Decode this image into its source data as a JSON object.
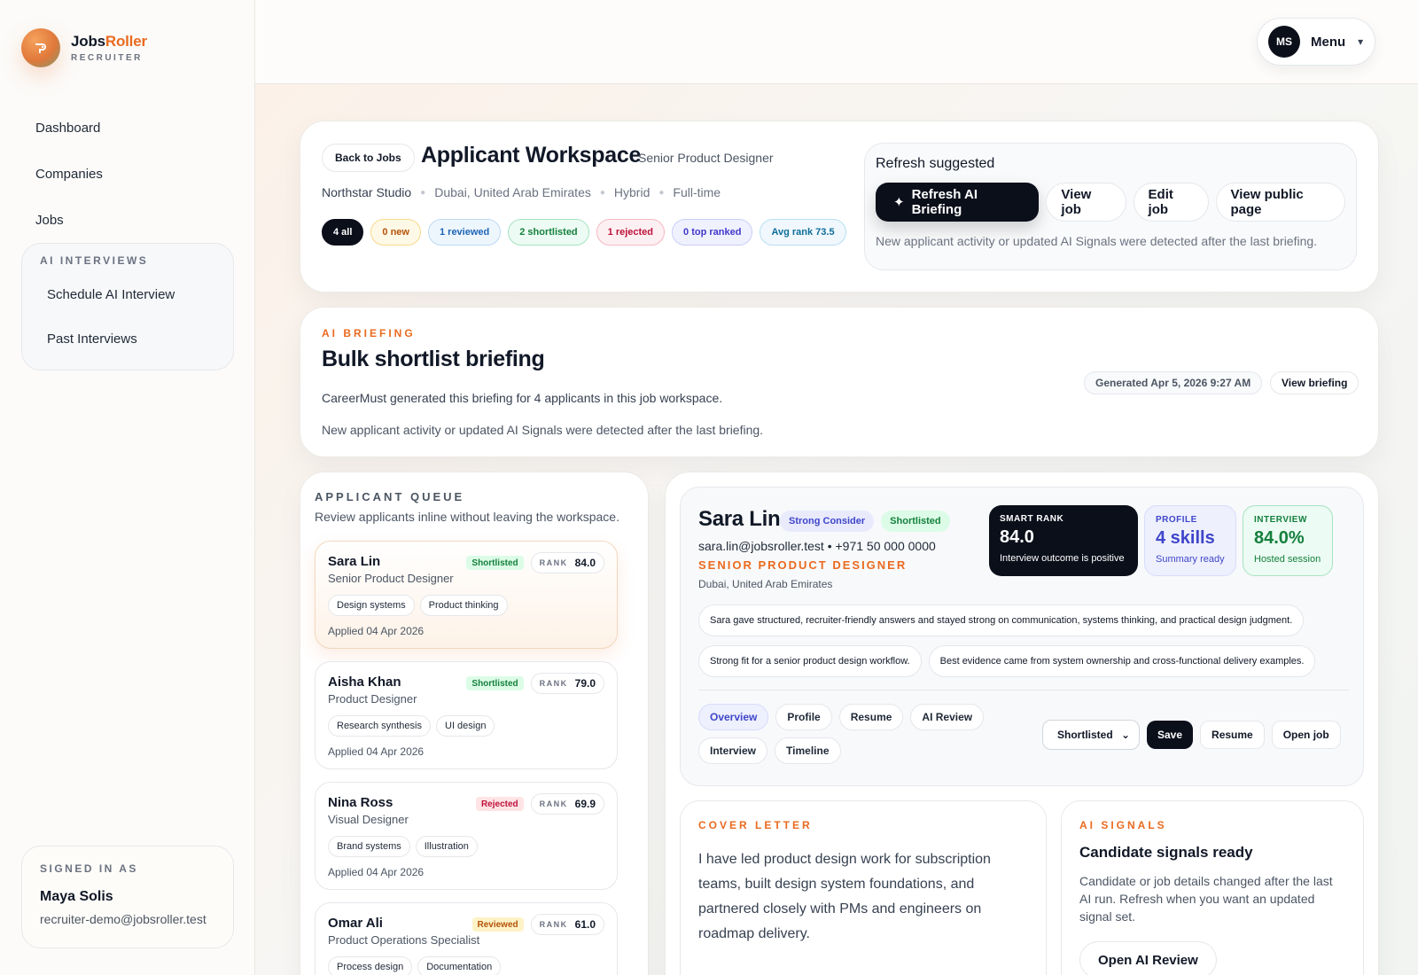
{
  "brand": {
    "name_main": "Jobs",
    "name_accent": "Roller",
    "sub": "RECRUITER",
    "accent": "#ea6a1f"
  },
  "nav": {
    "items": [
      "Dashboard",
      "Companies",
      "Jobs"
    ],
    "group_title": "AI INTERVIEWS",
    "group_items": [
      "Schedule AI Interview",
      "Past Interviews"
    ]
  },
  "signed_in": {
    "title": "SIGNED IN AS",
    "name": "Maya Solis",
    "email": "recruiter-demo@jobsroller.test"
  },
  "topbar": {
    "avatar": "MS",
    "menu": "Menu",
    "chevron": "▾"
  },
  "header": {
    "back": "Back to Jobs",
    "title": "Applicant Workspace",
    "role": "Senior Product Designer",
    "company": "Northstar Studio",
    "location": "Dubai, United Arab Emirates",
    "mode": "Hybrid",
    "type": "Full-time",
    "pills": [
      {
        "label": "4 all",
        "bg": "#0b0f1a",
        "fg": "#ffffff",
        "bd": "#0b0f1a"
      },
      {
        "label": "0 new",
        "bg": "#fef9e7",
        "fg": "#b45309",
        "bd": "#f6d98a"
      },
      {
        "label": "1 reviewed",
        "bg": "#eef6fd",
        "fg": "#1d64b5",
        "bd": "#bcd9f3"
      },
      {
        "label": "2 shortlisted",
        "bg": "#ecfbf3",
        "fg": "#15803d",
        "bd": "#a6e3c1"
      },
      {
        "label": "1 rejected",
        "bg": "#fdf0f2",
        "fg": "#be123c",
        "bd": "#f5b8c4"
      },
      {
        "label": "0 top ranked",
        "bg": "#f0f1fe",
        "fg": "#4338ca",
        "bd": "#c9cdf8"
      },
      {
        "label": "Avg rank 73.5",
        "bg": "#f0f8fd",
        "fg": "#0e6d99",
        "bd": "#b7def2"
      }
    ],
    "refresh": {
      "title": "Refresh suggested",
      "primary": "Refresh AI Briefing",
      "buttons": [
        "View job",
        "Edit job",
        "View public page"
      ],
      "note": "New applicant activity or updated AI Signals were detected after the last briefing."
    }
  },
  "briefing": {
    "eyebrow": "AI BRIEFING",
    "title": "Bulk shortlist briefing",
    "line1": "CareerMust generated this briefing for 4 applicants in this job workspace.",
    "line2": "New applicant activity or updated AI Signals were detected after the last briefing.",
    "generated": "Generated Apr 5, 2026 9:27 AM",
    "view": "View briefing"
  },
  "queue": {
    "title": "APPLICANT QUEUE",
    "subtitle": "Review applicants inline without leaving the workspace.",
    "rank_label": "RANK",
    "applicants": [
      {
        "name": "Sara Lin",
        "role": "Senior Product Designer",
        "status": "Shortlisted",
        "status_bg": "#dcfce7",
        "status_fg": "#15803d",
        "rank": "84.0",
        "tags": [
          "Design systems",
          "Product thinking"
        ],
        "date": "Applied 04 Apr 2026"
      },
      {
        "name": "Aisha Khan",
        "role": "Product Designer",
        "status": "Shortlisted",
        "status_bg": "#dcfce7",
        "status_fg": "#15803d",
        "rank": "79.0",
        "tags": [
          "Research synthesis",
          "UI design"
        ],
        "date": "Applied 04 Apr 2026"
      },
      {
        "name": "Nina Ross",
        "role": "Visual Designer",
        "status": "Rejected",
        "status_bg": "#ffe4e6",
        "status_fg": "#be123c",
        "rank": "69.9",
        "tags": [
          "Brand systems",
          "Illustration"
        ],
        "date": "Applied 04 Apr 2026"
      },
      {
        "name": "Omar Ali",
        "role": "Product Operations Specialist",
        "status": "Reviewed",
        "status_bg": "#fef3c7",
        "status_fg": "#b45309",
        "rank": "61.0",
        "tags": [
          "Process design",
          "Documentation"
        ],
        "date": ""
      }
    ]
  },
  "profile": {
    "name": "Sara Lin",
    "badges": [
      {
        "label": "Strong Consider",
        "bg": "#e9ebfd",
        "fg": "#3f46c9"
      },
      {
        "label": "Shortlisted",
        "bg": "#dcfce7",
        "fg": "#15803d"
      }
    ],
    "contact": "sara.lin@jobsroller.test • +971 50 000 0000",
    "role": "SENIOR PRODUCT DESIGNER",
    "location": "Dubai, United Arab Emirates",
    "stats": [
      {
        "label": "SMART RANK",
        "value": "84.0",
        "sub": "Interview outcome is positive"
      },
      {
        "label": "PROFILE",
        "value": "4 skills",
        "sub": "Summary ready"
      },
      {
        "label": "INTERVIEW",
        "value": "84.0%",
        "sub": "Hosted session"
      }
    ],
    "insights": [
      "Sara gave structured, recruiter-friendly answers and stayed strong on communication, systems thinking, and practical design judgment.",
      "Strong fit for a senior product design workflow.",
      "Best evidence came from system ownership and cross-functional delivery examples."
    ],
    "tabs": [
      "Overview",
      "Profile",
      "Resume",
      "AI Review",
      "Interview",
      "Timeline"
    ],
    "status_select": "Shortlisted",
    "save": "Save",
    "resume": "Resume",
    "open_job": "Open job"
  },
  "cover": {
    "eyebrow": "COVER LETTER",
    "text": "I have led product design work for subscription teams, built design system foundations, and partnered closely with PMs and engineers on roadmap delivery."
  },
  "signals": {
    "eyebrow": "AI SIGNALS",
    "title": "Candidate signals ready",
    "text": "Candidate or job details changed after the last AI run. Refresh when you want an updated signal set.",
    "button": "Open AI Review"
  }
}
